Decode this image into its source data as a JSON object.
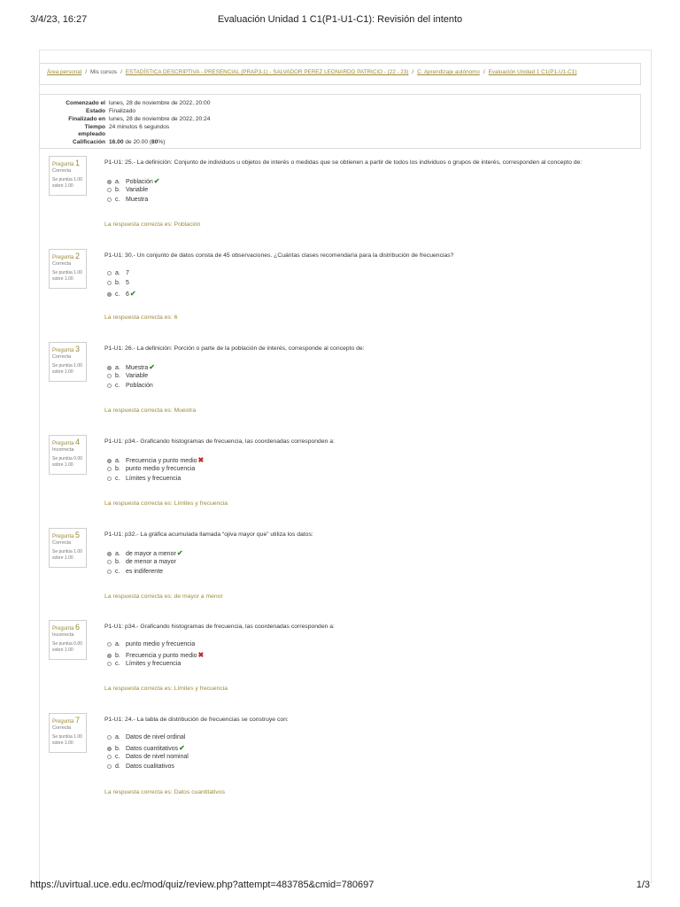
{
  "print_header": {
    "date": "3/4/23, 16:27",
    "title": "Evaluación Unidad 1 C1(P1-U1-C1): Revisión del intento"
  },
  "breadcrumb": [
    {
      "label": "Área personal",
      "link": true
    },
    {
      "label": "Mis cursos",
      "link": false
    },
    {
      "label": "ESTADÍSTICA DESCRIPTIVA - PRESENCIAL (PRAP3-1) - SALVADOR PEREZ LEONARDO PATRICIO - (22 - 23)",
      "link": true
    },
    {
      "label": "C. Aprendizaje autónomo",
      "link": true
    },
    {
      "label": "Evaluación Unidad 1 C1(P1-U1-C1)",
      "link": true
    }
  ],
  "summary": {
    "started_label": "Comenzado el",
    "started": "lunes, 28 de noviembre de 2022, 20:00",
    "state_label": "Estado",
    "state": "Finalizado",
    "finished_label": "Finalizado en",
    "finished": "lunes, 28 de noviembre de 2022, 20:24",
    "time_label_1": "Tiempo",
    "time_label_2": "empleado",
    "time": "24 minutos 6 segundos",
    "grade_label": "Calificación",
    "grade_bold": "16.00",
    "grade_mid": " de 20.00 (",
    "grade_pct": "80",
    "grade_end": "%)"
  },
  "questions": [
    {
      "prefix": "Pregunta",
      "number": "1",
      "state": "Correcta",
      "grade1": "Se puntúa 1.00",
      "grade2": "sobre 1.00",
      "text": "P1-U1: 25.- La definición: Conjunto de individuos u objetos de interés o medidas que se obtienen a partir de todos los individuos o grupos de interés, corresponden al concepto de:",
      "options": [
        {
          "letter": "a.",
          "text": "Población",
          "selected": true,
          "mark": "✔"
        },
        {
          "letter": "b.",
          "text": "Variable",
          "selected": false,
          "mark": ""
        },
        {
          "letter": "c.",
          "text": "Muestra",
          "selected": false,
          "mark": ""
        }
      ],
      "answer": "La respuesta correcta es: Población"
    },
    {
      "prefix": "Pregunta",
      "number": "2",
      "state": "Correcta",
      "grade1": "Se puntúa 1.00",
      "grade2": "sobre 1.00",
      "text": "P1-U1: 30.- Un conjunto de datos consta de 45 observaciones. ¿Cuántas clases recomendaría para la distribución de frecuencias?",
      "options": [
        {
          "letter": "a.",
          "text": "7",
          "selected": false,
          "mark": ""
        },
        {
          "letter": "b.",
          "text": "5",
          "selected": false,
          "mark": ""
        },
        {
          "letter": "c.",
          "text": "6",
          "selected": true,
          "mark": "✔"
        }
      ],
      "answer": "La respuesta correcta es: 6"
    },
    {
      "prefix": "Pregunta",
      "number": "3",
      "state": "Correcta",
      "grade1": "Se puntúa 1.00",
      "grade2": "sobre 1.00",
      "text": "P1-U1: 26.- La definición: Porción o parte de la población de interés, corresponde al concepto de:",
      "options": [
        {
          "letter": "a.",
          "text": "Muestra",
          "selected": true,
          "mark": "✔"
        },
        {
          "letter": "b.",
          "text": "Variable",
          "selected": false,
          "mark": ""
        },
        {
          "letter": "c.",
          "text": "Población",
          "selected": false,
          "mark": ""
        }
      ],
      "answer": "La respuesta correcta es: Muestra"
    },
    {
      "prefix": "Pregunta",
      "number": "4",
      "state": "Incorrecta",
      "grade1": "Se puntúa 0.00",
      "grade2": "sobre 1.00",
      "text": "P1-U1: p34.- Graficando histogramas de frecuencia, las coordenadas corresponden a:",
      "options": [
        {
          "letter": "a.",
          "text": "Frecuencia y punto medio",
          "selected": true,
          "mark": "✖"
        },
        {
          "letter": "b.",
          "text": "punto medio y frecuencia",
          "selected": false,
          "mark": ""
        },
        {
          "letter": "c.",
          "text": "Límites y frecuencia",
          "selected": false,
          "mark": ""
        }
      ],
      "answer": "La respuesta correcta es: Límites y frecuencia"
    },
    {
      "prefix": "Pregunta",
      "number": "5",
      "state": "Correcta",
      "grade1": "Se puntúa 1.00",
      "grade2": "sobre 1.00",
      "text": "P1-U1: p32.- La gráfica acumulada llamada “ojiva mayor que” utiliza los datos:",
      "options": [
        {
          "letter": "a.",
          "text": "de mayor a menor",
          "selected": true,
          "mark": "✔"
        },
        {
          "letter": "b.",
          "text": "de menor a mayor",
          "selected": false,
          "mark": ""
        },
        {
          "letter": "c.",
          "text": "es indiferente",
          "selected": false,
          "mark": ""
        }
      ],
      "answer": "La respuesta correcta es: de mayor a menor"
    },
    {
      "prefix": "Pregunta",
      "number": "6",
      "state": "Incorrecta",
      "grade1": "Se puntúa 0.00",
      "grade2": "sobre 1.00",
      "text": "P1-U1: p34.- Graficando histogramas de frecuencia, las coordenadas corresponden a:",
      "options": [
        {
          "letter": "a.",
          "text": "punto medio y frecuencia",
          "selected": false,
          "mark": ""
        },
        {
          "letter": "b.",
          "text": "Frecuencia y punto medio",
          "selected": true,
          "mark": "✖"
        },
        {
          "letter": "c.",
          "text": "Límites y frecuencia",
          "selected": false,
          "mark": ""
        }
      ],
      "answer": "La respuesta correcta es: Límites y frecuencia"
    },
    {
      "prefix": "Pregunta",
      "number": "7",
      "state": "Correcta",
      "grade1": "Se puntúa 1.00",
      "grade2": "sobre 1.00",
      "text": "P1-U1: 24.- La tabla de distribución de frecuencias se construye con:",
      "options": [
        {
          "letter": "a.",
          "text": "Datos de nivel ordinal",
          "selected": false,
          "mark": ""
        },
        {
          "letter": "b.",
          "text": "Datos cuantitativos",
          "selected": true,
          "mark": "✔"
        },
        {
          "letter": "c.",
          "text": "Datos de nivel nominal",
          "selected": false,
          "mark": ""
        },
        {
          "letter": "d.",
          "text": "Datos cualitativos",
          "selected": false,
          "mark": ""
        }
      ],
      "answer": "La respuesta correcta es: Datos cuantitativos"
    }
  ],
  "print_footer": {
    "url": "https://uvirtual.uce.edu.ec/mod/quiz/review.php?attempt=483785&cmid=780697",
    "page": "1/3"
  },
  "colors": {
    "link": "#9c8a3a",
    "correct": "#2e8b2e",
    "incorrect": "#c02a2a"
  }
}
